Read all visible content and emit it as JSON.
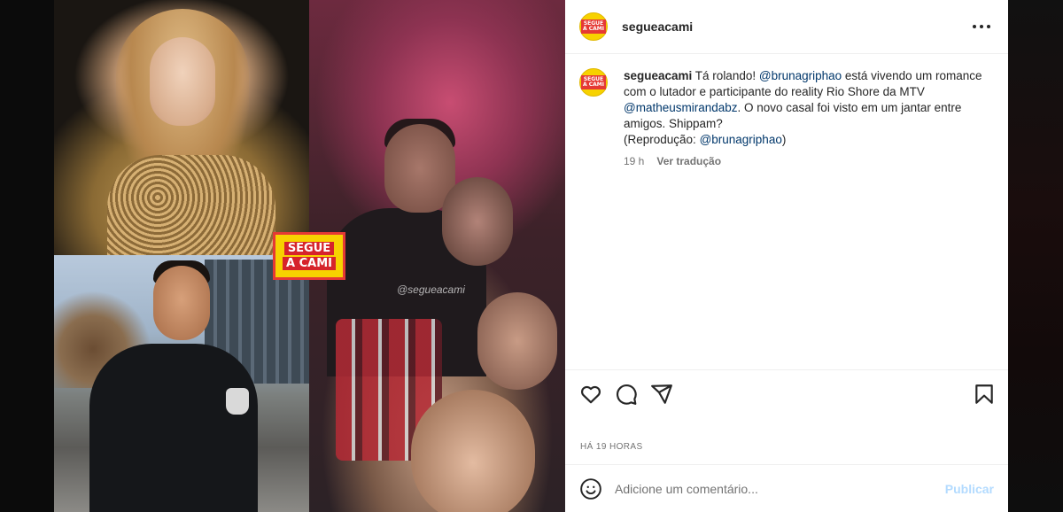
{
  "post": {
    "username": "segueacami",
    "avatar_badge": [
      "SEGUE",
      "A CAMI"
    ],
    "media": {
      "watermark": "@segueacami",
      "badge_lines": [
        "SEGUE",
        "A CAMI"
      ]
    },
    "caption": {
      "username": "segueacami",
      "text_1": " Tá rolando! ",
      "mention_1": "@brunagriphao",
      "text_2": " está vivendo um romance com o lutador e participante do reality Rio Shore da MTV ",
      "mention_2": "@matheusmirandabz",
      "text_3": ". O novo casal foi visto em um jantar entre amigos. Shippam?",
      "text_4": "(Reprodução: ",
      "mention_3": "@brunagriphao",
      "text_5": ")"
    },
    "caption_meta": {
      "age": "19 h",
      "translate_label": "Ver tradução"
    },
    "time_ago": "HÁ 19 HORAS",
    "comment": {
      "placeholder": "Adicione um comentário...",
      "publish_label": "Publicar"
    }
  },
  "icons": {
    "more": "more-horizontal-icon",
    "like": "heart-icon",
    "comment": "comment-icon",
    "share": "share-icon",
    "save": "bookmark-icon",
    "emoji": "emoji-icon"
  },
  "colors": {
    "mention": "#00376b",
    "publish_disabled": "#b3dbff",
    "badge_yellow": "#f7d200",
    "badge_red": "#d6232b"
  }
}
